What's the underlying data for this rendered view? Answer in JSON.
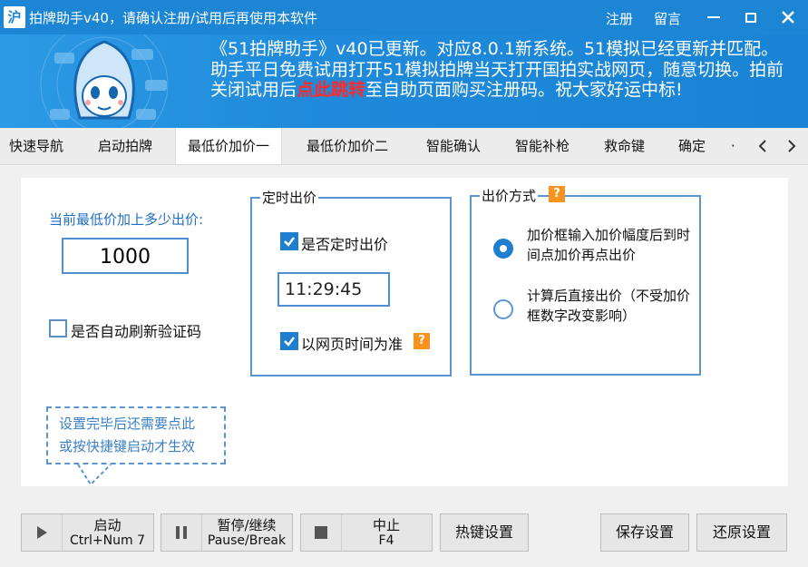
{
  "window": {
    "title": "拍牌助手v40，请确认注册/试用后再使用本软件",
    "app_icon_glyph": "沪",
    "register_link": "注册",
    "message_link": "留言"
  },
  "banner": {
    "part1": "《51拍牌助手》v40已更新。对应8.0.1新系统。51模拟已经更新并匹配。助手平日免费试用打开51模拟拍牌当天打开国拍实战网页，随意切换。拍前关闭试用后",
    "highlight": "点此跳转",
    "part2": "至自助页面购买注册码。祝大家好运中标!"
  },
  "tabs": [
    "快速导航",
    "启动拍牌",
    "最低价加价一",
    "最低价加价二",
    "智能确认",
    "智能补枪",
    "救命键",
    "确定",
    "·"
  ],
  "tab_active": "最低价加价一",
  "left": {
    "prompt": "当前最低价加上多少出价:",
    "amount": "1000",
    "auto_refresh_label": "是否自动刷新验证码",
    "auto_refresh_checked": false
  },
  "timed_bid": {
    "title": "定时出价",
    "timed_label": "是否定时出价",
    "timed_checked": true,
    "time_value": "11:29:45",
    "web_time_label": "以网页时间为准",
    "web_time_checked": true
  },
  "bid_mode": {
    "title": "出价方式",
    "option1": "加价框输入加价幅度后到时间点加价再点出价",
    "option2": "计算后直接出价（不受加价框数字改变影响）",
    "selected": 1
  },
  "tip": {
    "line1": "设置完毕后还需要点此",
    "line2": "或按快捷键启动才生效"
  },
  "buttons": {
    "start_label": "启动",
    "start_shortcut": "Ctrl+Num 7",
    "pause_label": "暂停/继续",
    "pause_shortcut": "Pause/Break",
    "stop_label": "中止",
    "stop_shortcut": "F4",
    "hotkey_label": "热键设置",
    "save_label": "保存设置",
    "restore_label": "还原设置"
  },
  "colors": {
    "titlebar": "#1d86d4",
    "accent": "#1e7fd1",
    "highlight_red": "#ff2a2a",
    "help_orange": "#f7931e"
  }
}
